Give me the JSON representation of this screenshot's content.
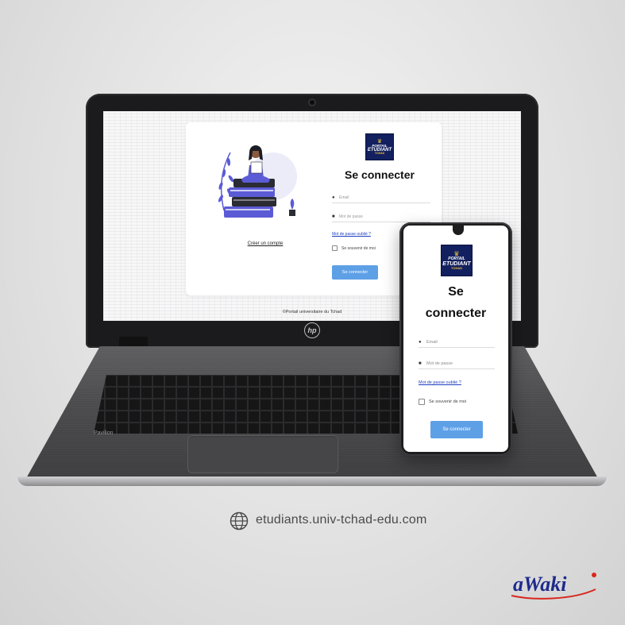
{
  "desktop": {
    "brand": "hp",
    "model": "Pavilion",
    "login_page": {
      "logo": {
        "line1": "PORTAIL",
        "line2": "ETUDIANT",
        "line3": "TCHAD"
      },
      "title": "Se connecter",
      "email_placeholder": "Email",
      "password_placeholder": "Mot de passe",
      "forgot_password": "Mot de passe oublié ?",
      "remember_me": "Se souvenir de moi",
      "submit": "Se connecter",
      "create_account": "Créer un compte",
      "footer": "©Portail universitaire du Tchad"
    }
  },
  "mobile": {
    "logo": {
      "line1": "PORTAIL",
      "line2": "ETUDIANT",
      "line3": "TCHAD"
    },
    "title_line1": "Se",
    "title_line2": "connecter",
    "email_placeholder": "Email",
    "password_placeholder": "Mot de passe",
    "forgot_password": "Mot de passe oublié ?",
    "remember_me": "Se souvenir de moi",
    "submit": "Se connecter"
  },
  "website": {
    "url": "etudiants.univ-tchad-edu.com",
    "icon": "globe-icon"
  },
  "brand_mark": "aWaki",
  "colors": {
    "primary_button": "#5ea0e6",
    "logo_background": "#13205f",
    "logo_accent": "#f0c23c",
    "illustration": "#5b5bd6",
    "link": "#1f3fbf"
  }
}
